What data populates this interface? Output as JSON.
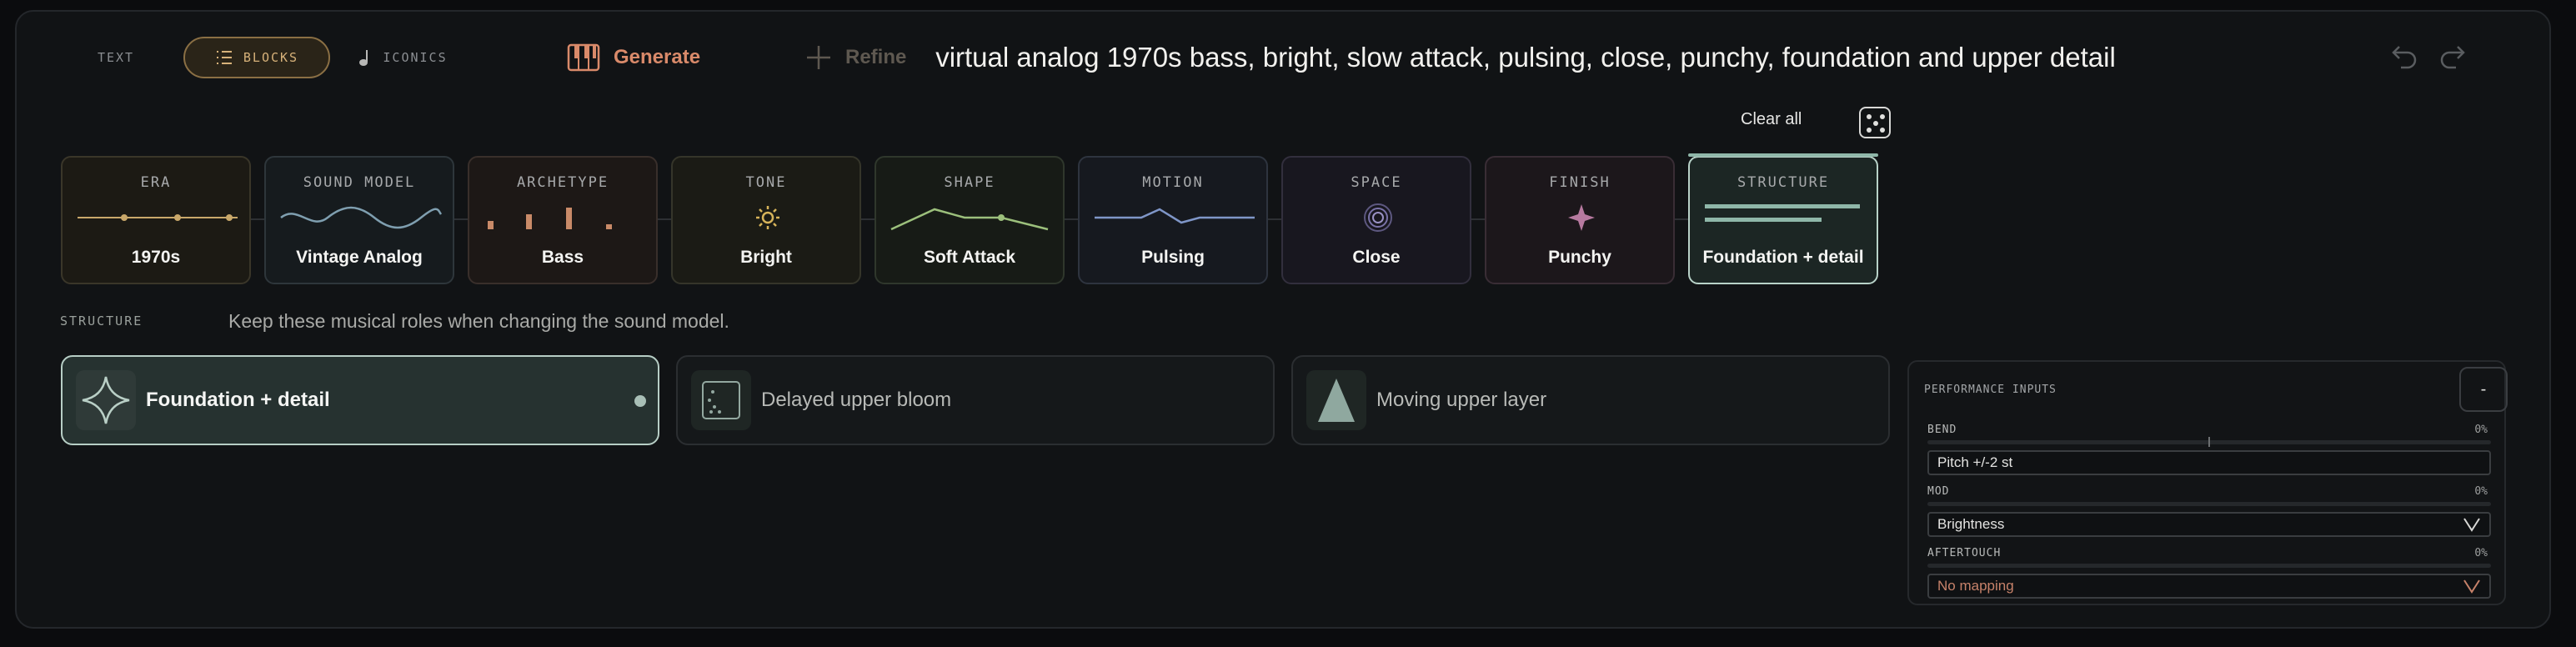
{
  "modes": {
    "text": "TEXT",
    "blocks": "BLOCKS",
    "iconics": "ICONICS",
    "active": "BLOCKS"
  },
  "actions": {
    "generate": "Generate",
    "refine": "Refine"
  },
  "prompt": "virtual analog 1970s bass, bright, slow attack, pulsing, close, punchy, foundation and upper detail",
  "clear_all": "Clear all",
  "blocks": [
    {
      "title": "ERA",
      "value": "1970s",
      "color": "#c9a86a"
    },
    {
      "title": "SOUND MODEL",
      "value": "Vintage Analog",
      "color": "#7f9fb0"
    },
    {
      "title": "ARCHETYPE",
      "value": "Bass",
      "color": "#c98a68"
    },
    {
      "title": "TONE",
      "value": "Bright",
      "color": "#d7b45a"
    },
    {
      "title": "SHAPE",
      "value": "Soft Attack",
      "color": "#9cc07c"
    },
    {
      "title": "MOTION",
      "value": "Pulsing",
      "color": "#7f96c8"
    },
    {
      "title": "SPACE",
      "value": "Close",
      "color": "#9a92c4"
    },
    {
      "title": "FINISH",
      "value": "Punchy",
      "color": "#b77aa0"
    },
    {
      "title": "STRUCTURE",
      "value": "Foundation + detail",
      "color": "#8fb7a9",
      "active": true
    }
  ],
  "structure": {
    "label": "STRUCTURE",
    "description": "Keep these musical roles when changing the sound model.",
    "roles": [
      {
        "name": "Foundation + detail",
        "selected": true
      },
      {
        "name": "Delayed upper bloom",
        "selected": false
      },
      {
        "name": "Moving upper layer",
        "selected": false
      }
    ]
  },
  "performance": {
    "title": "PERFORMANCE INPUTS",
    "collapse": "-",
    "inputs": [
      {
        "label": "BEND",
        "value": "0%",
        "mapping": "Pitch +/-2 st"
      },
      {
        "label": "MOD",
        "value": "0%",
        "mapping": "Brightness"
      },
      {
        "label": "AFTERTOUCH",
        "value": "0%",
        "mapping": "No mapping"
      }
    ]
  }
}
